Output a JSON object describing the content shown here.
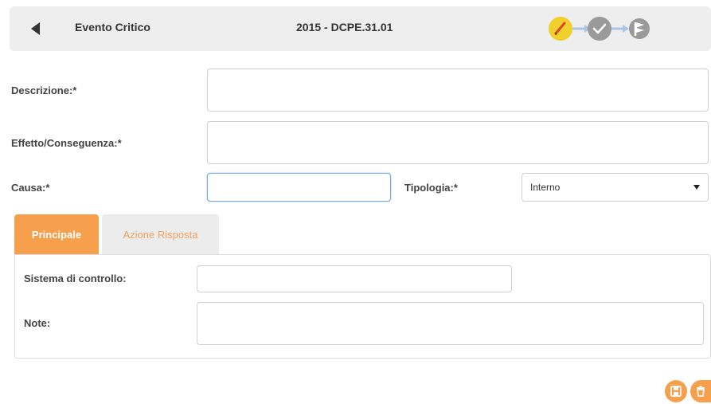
{
  "header": {
    "title": "Evento Critico",
    "code": "2015 - DCPE.31.01",
    "workflow_steps": [
      {
        "icon": "pencil-icon",
        "state": "current",
        "color": "#f2d02b"
      },
      {
        "icon": "check-icon",
        "state": "pending",
        "color": "#9a9a9a"
      },
      {
        "icon": "flag-icon",
        "state": "pending",
        "color": "#9a9a9a"
      }
    ]
  },
  "form": {
    "descrizione": {
      "label": "Descrizione:*",
      "value": ""
    },
    "effetto": {
      "label": "Effetto/Conseguenza:*",
      "value": ""
    },
    "causa": {
      "label": "Causa:*",
      "value": ""
    },
    "tipologia": {
      "label": "Tipologia:*",
      "selected": "Interno"
    }
  },
  "tabs": [
    {
      "label": "Principale",
      "active": true
    },
    {
      "label": "Azione Risposta",
      "active": false
    }
  ],
  "panel": {
    "sistema": {
      "label": "Sistema di controllo:",
      "value": ""
    },
    "note": {
      "label": "Note:",
      "value": ""
    }
  },
  "actions": [
    {
      "icon": "save-icon"
    },
    {
      "icon": "trash-icon"
    }
  ],
  "colors": {
    "accent": "#f6a04e",
    "header_bg": "#eeeeee",
    "workflow_current": "#f2d02b",
    "workflow_pending": "#9a9a9a",
    "focus_border": "#7aa7e0"
  }
}
